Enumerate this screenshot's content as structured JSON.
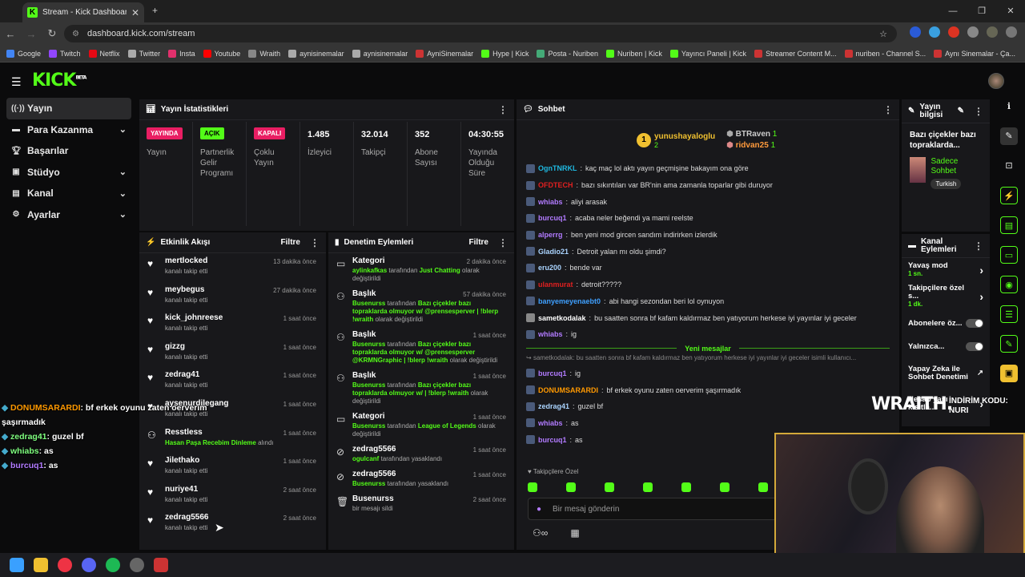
{
  "browser": {
    "tab_title": "Stream - Kick Dashboard",
    "url": "dashboard.kick.com/stream",
    "bookmarks": [
      "Google",
      "Twitch",
      "Netflix",
      "Twitter",
      "Insta",
      "Youtube",
      "Wraith",
      "aynisinemalar",
      "aynisinemalar",
      "AyniSinemalar",
      "Hype | Kick",
      "Posta - Nuriben",
      "Nuriben | Kick",
      "Yayıncı Paneli | Kick",
      "Streamer Content M...",
      "nuriben - Channel S...",
      "Aynı Sinemalar - Ça..."
    ]
  },
  "logo": "KICK",
  "logo_sup": "BETA",
  "sidebar": {
    "items": [
      {
        "label": "Yayın",
        "icon": "broadcast-icon"
      },
      {
        "label": "Para Kazanma",
        "icon": "money-icon"
      },
      {
        "label": "Başarılar",
        "icon": "trophy-icon"
      },
      {
        "label": "Stüdyo",
        "icon": "studio-icon"
      },
      {
        "label": "Kanal",
        "icon": "channel-icon"
      },
      {
        "label": "Ayarlar",
        "icon": "gear-icon"
      }
    ]
  },
  "stats": {
    "title": "Yayın İstatistikleri",
    "cells": [
      {
        "badge": "YAYINDA",
        "label": "Yayın"
      },
      {
        "badge": "AÇIK",
        "label": "Partnerlik Gelir Programı"
      },
      {
        "badge": "KAPALI",
        "label": "Çoklu Yayın"
      },
      {
        "value": "1.485",
        "label": "İzleyici"
      },
      {
        "value": "32.014",
        "label": "Takipçi"
      },
      {
        "value": "352",
        "label": "Abone Sayısı"
      },
      {
        "value": "04:30:55",
        "label": "Yayında Olduğu Süre"
      }
    ]
  },
  "activity": {
    "title": "Etkinlik Akışı",
    "filter": "Filtre",
    "items": [
      {
        "name": "mertlocked",
        "sub": "kanalı takip etti",
        "time": "13 dakika önce"
      },
      {
        "name": "meybegus",
        "sub": "kanalı takip etti",
        "time": "27 dakika önce"
      },
      {
        "name": "kick_johnreese",
        "sub": "kanalı takip etti",
        "time": "1 saat önce"
      },
      {
        "name": "gizzg",
        "sub": "kanalı takip etti",
        "time": "1 saat önce"
      },
      {
        "name": "zedrag41",
        "sub": "kanalı takip etti",
        "time": "1 saat önce"
      },
      {
        "name": "aysenurdilegang",
        "sub": "kanalı takip etti",
        "time": "1 saat önce"
      },
      {
        "name": "Resstless",
        "sub_green": "Hasan Paşa Recebim Dinleme",
        "sub": "alındı",
        "time": "1 saat önce"
      },
      {
        "name": "Jilethako",
        "sub": "kanalı takip etti",
        "time": "1 saat önce"
      },
      {
        "name": "nuriye41",
        "sub": "kanalı takip etti",
        "time": "2 saat önce"
      },
      {
        "name": "zedrag5566",
        "sub": "kanalı takip etti",
        "time": "2 saat önce"
      }
    ]
  },
  "moderation": {
    "title": "Denetim Eylemleri",
    "filter": "Filtre",
    "items": [
      {
        "name": "Kategori",
        "user": "aylinkafkas",
        "mid": "tarafından",
        "value": "Just Chatting",
        "tail": "olarak değiştirildi",
        "time": "2 dakika önce"
      },
      {
        "name": "Başlık",
        "user": "Busenurss",
        "mid": "tarafından",
        "value": "Bazı çiçekler bazı topraklarda olmuyor w/ @prensesperver | !blerp !wraith",
        "tail": "olarak değiştirildi",
        "time": "57 dakika önce"
      },
      {
        "name": "Başlık",
        "user": "Busenurss",
        "mid": "tarafından",
        "value": "Bazı çiçekler bazı topraklarda olmuyor w/ @prensesperver @KRMNGraphic | !blerp !wraith",
        "tail": "olarak değiştirildi",
        "time": "1 saat önce"
      },
      {
        "name": "Başlık",
        "user": "Busenurss",
        "mid": "tarafından",
        "value": "Bazı çiçekler bazı topraklarda olmuyor w/ | !blerp !wraith",
        "tail": "olarak değiştirildi",
        "time": "1 saat önce"
      },
      {
        "name": "Kategori",
        "user": "Busenurss",
        "mid": "tarafından",
        "value": "League of Legends",
        "tail": "olarak değiştirildi",
        "time": "1 saat önce"
      },
      {
        "name": "zedrag5566",
        "user": "ogulcanf",
        "mid": "tarafından yasaklandı",
        "value": "",
        "tail": "",
        "time": "1 saat önce"
      },
      {
        "name": "zedrag5566",
        "user": "Busenurss",
        "mid": "tarafından yasaklandı",
        "value": "",
        "tail": "",
        "time": "1 saat önce"
      },
      {
        "name": "Busenurss",
        "user": "",
        "mid": "bir mesajı sildi",
        "value": "",
        "tail": "",
        "time": "2 saat önce"
      }
    ]
  },
  "chat": {
    "title": "Sohbet",
    "top_supporters": [
      {
        "name": "yunushayaloglu",
        "count": "2"
      },
      {
        "name": "BTRaven",
        "count": "1"
      },
      {
        "name": "ridvan25",
        "count": "1"
      }
    ],
    "messages": [
      {
        "user": "OgnTNRKL",
        "color": "#1fb8e0",
        "text": "kaç maç lol aktı yayın geçmişine bakayım ona göre"
      },
      {
        "user": "OFDTECH",
        "color": "#e02020",
        "text": "bazı sıkıntıları var BR'nin ama zamanla toparlar gibi duruyor"
      },
      {
        "user": "whiabs",
        "color": "#b27bff",
        "text": "aliyi arasak"
      },
      {
        "user": "burcuq1",
        "color": "#b27bff",
        "text": "acaba neler beğendi ya mami reelste"
      },
      {
        "user": "alperrg",
        "color": "#b27bff",
        "text": "ben yeni mod gircen sandım indirirken izlerdik"
      },
      {
        "user": "Gladio21",
        "color": "#aad4ff",
        "text": "Detroit yalan mı oldu şimdi?"
      },
      {
        "user": "eru200",
        "color": "#aad4ff",
        "text": "bende var"
      },
      {
        "user": "ulanmurat",
        "color": "#e02020",
        "text": "detroit?????"
      },
      {
        "user": "banyemeyenaebt0",
        "color": "#3fa0ff",
        "text": "abi hangi sezondan beri lol oynuyon"
      },
      {
        "user": "sametkodalak",
        "color": "#ffffff",
        "text": "bu saatten sonra bf kafam kaldırmaz ben yatıyorum herkese iyi yayınlar iyi geceler"
      },
      {
        "user": "whiabs",
        "color": "#b27bff",
        "text": "ig"
      }
    ],
    "divider": "Yeni mesajlar",
    "reply_preview": "sametkodalak: bu saatten sonra bf kafam kaldırmaz ben yatıyorum herkese iyi yayınlar iyi geceler isimli kullanıcı...",
    "new_messages": [
      {
        "user": "burcuq1",
        "color": "#b27bff",
        "text": "ig"
      },
      {
        "user": "DONUMSARARDI",
        "color": "#ff9900",
        "text": "bf erkek oyunu zaten oerverim şaşırmadık"
      },
      {
        "user": "zedrag41",
        "color": "#aad4ff",
        "text": "guzel bf"
      },
      {
        "user": "whiabs",
        "color": "#b27bff",
        "text": "as"
      },
      {
        "user": "burcuq1",
        "color": "#b27bff",
        "text": "as"
      }
    ],
    "followers_only": "Takipçilere Özel",
    "input_placeholder": "Bir mesaj gönderin"
  },
  "stream_info": {
    "title": "Yayın bilgisi",
    "stream_title": "Bazı çiçekler bazı topraklarda...",
    "category": "Sadece Sohbet",
    "language": "Turkish"
  },
  "channel_actions": {
    "title": "Kanal Eylemleri",
    "items": [
      {
        "label": "Yavaş mod",
        "sub": "1 sn.",
        "control": "chevron"
      },
      {
        "label": "Takipçilere özel s...",
        "sub": "1 dk.",
        "control": "chevron"
      },
      {
        "label": "Abonelere öz...",
        "sub": "",
        "control": "toggle"
      },
      {
        "label": "Yalnızca...",
        "sub": "",
        "control": "toggle"
      },
      {
        "label": "Yapay Zeka ile Sohbet Denetimi",
        "sub": "",
        "control": "external"
      },
      {
        "label": "Hesap yaşı kısıtla...",
        "sub": "",
        "control": "chevron"
      }
    ]
  },
  "overlay_chat": [
    {
      "user": "DONUMSARARDI",
      "color": "#ff9900",
      "text": ": bf erkek oyunu zaten oerverim şaşırmadık"
    },
    {
      "user": "zedrag41",
      "color": "#7fff7f",
      "text": ": guzel bf"
    },
    {
      "user": "whiabs",
      "color": "#7fff7f",
      "text": ": as"
    },
    {
      "user": "burcuq1",
      "color": "#b27bff",
      "text": ": as"
    }
  ],
  "wraith_banner": {
    "brand": "WRAITH.",
    "code_label": "İNDİRİM KODU:",
    "code": "NURI"
  },
  "colors": {
    "accent": "#53fc18",
    "panel": "#18181b",
    "live_badge": "#e91e63"
  }
}
